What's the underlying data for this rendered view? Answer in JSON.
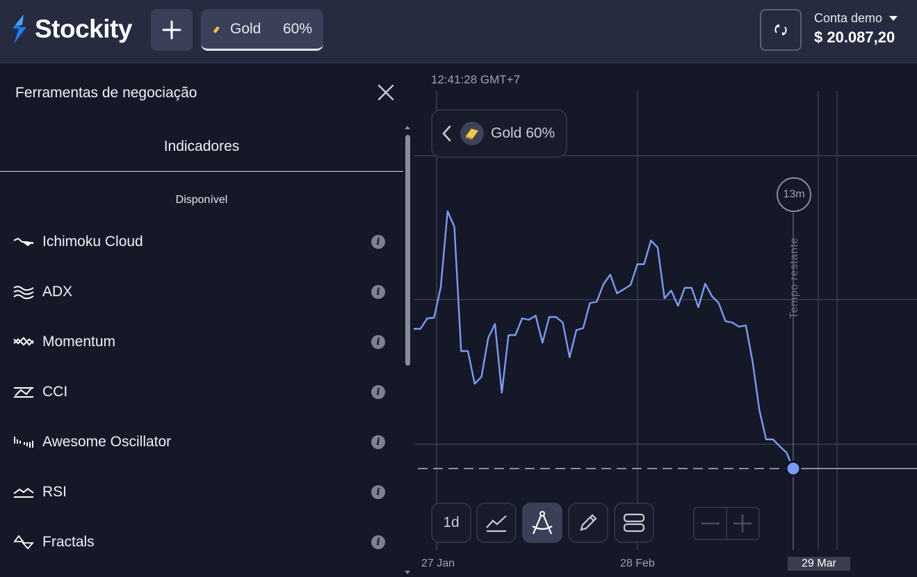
{
  "header": {
    "brand": "Stockity",
    "asset_tab": {
      "name": "Gold",
      "payout": "60%"
    },
    "account": {
      "label": "Conta demo",
      "balance": "$ 20.087,20"
    }
  },
  "panel": {
    "title": "Ferramentas de negociação",
    "tab": "Indicadores",
    "section": "Disponível",
    "items": [
      {
        "label": "Ichimoku Cloud",
        "icon": "ichimoku-icon"
      },
      {
        "label": "ADX",
        "icon": "adx-icon"
      },
      {
        "label": "Momentum",
        "icon": "momentum-icon"
      },
      {
        "label": "CCI",
        "icon": "cci-icon"
      },
      {
        "label": "Awesome Oscillator",
        "icon": "awesome-oscillator-icon"
      },
      {
        "label": "RSI",
        "icon": "rsi-icon"
      },
      {
        "label": "Fractals",
        "icon": "fractals-icon"
      }
    ],
    "info_glyph": "i"
  },
  "chart": {
    "clock": "12:41:28 GMT+7",
    "asset_chip": "Gold 60%",
    "timer": "13m",
    "remaining_label": "Tempo restante",
    "timeframe": "1d",
    "x_labels": [
      "27 Jan",
      "28 Feb",
      "29 Mar"
    ],
    "colors": {
      "line": "#7b9cf5",
      "grid": "#3a3f52",
      "point": "#7b9cf5"
    }
  },
  "chart_data": {
    "type": "line",
    "xlabel": "",
    "ylabel": "",
    "x_tick_labels": [
      "27 Jan",
      "28 Feb",
      "29 Mar"
    ],
    "series": [
      {
        "values": [
          473,
          473,
          458,
          457,
          413,
          304,
          326,
          505,
          505,
          552,
          542,
          486,
          466,
          565,
          482,
          482,
          458,
          460,
          454,
          493,
          456,
          456,
          464,
          514,
          475,
          472,
          436,
          434,
          409,
          395,
          422,
          416,
          410,
          380,
          380,
          346,
          356,
          429,
          418,
          440,
          414,
          414,
          442,
          408,
          426,
          436,
          462,
          464,
          470,
          468,
          520,
          590,
          632,
          632,
          642,
          651,
          674
        ]
      }
    ],
    "y_inverted_note": "",
    "current_value_dashed": true
  }
}
